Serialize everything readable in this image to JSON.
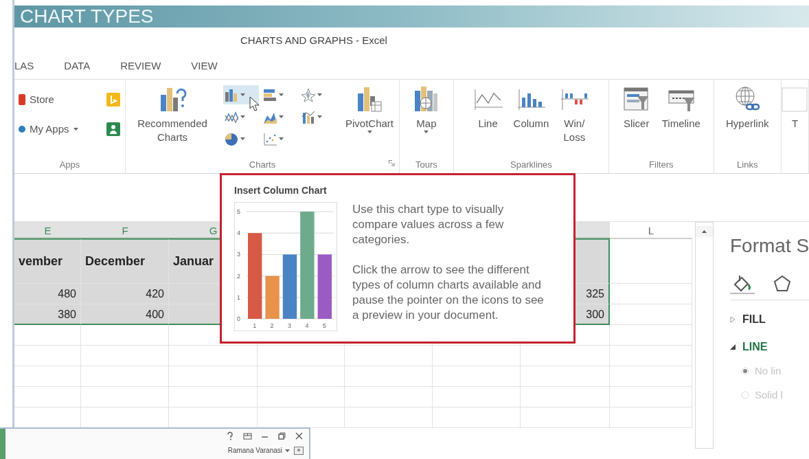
{
  "banner": {
    "title": "CHART TYPES"
  },
  "window": {
    "title": "CHARTS AND GRAPHS - Excel"
  },
  "tabs": [
    {
      "label": "LAS"
    },
    {
      "label": "DATA"
    },
    {
      "label": "REVIEW"
    },
    {
      "label": "VIEW"
    }
  ],
  "ribbon": [
    {
      "label": "Apps",
      "kind": "apps",
      "buttons": [
        {
          "kind": "applist",
          "items": [
            {
              "label": "Store",
              "kind": "store",
              "has_menu": false,
              "addin": {
                "kind": "bing"
              }
            },
            {
              "label": "My Apps",
              "kind": "myapps",
              "has_menu": true,
              "addin": {
                "kind": "people"
              }
            }
          ]
        }
      ]
    },
    {
      "label": "Charts",
      "kind": "charts",
      "dialog_launcher": true,
      "buttons": [
        {
          "kind": "recommended",
          "label": "Recommended Charts",
          "has_menu": false
        },
        {
          "kind": "gallery",
          "items": [
            {
              "kind": "column",
              "highlighted": true,
              "has_menu": true
            },
            {
              "kind": "bar",
              "highlighted": false,
              "has_menu": true
            },
            {
              "kind": "radar",
              "highlighted": false,
              "has_menu": true
            },
            {
              "kind": "line",
              "highlighted": false,
              "has_menu": true
            },
            {
              "kind": "area",
              "highlighted": false,
              "has_menu": true
            },
            {
              "kind": "combo",
              "highlighted": false,
              "has_menu": true
            },
            {
              "kind": "pie",
              "highlighted": false,
              "has_menu": true
            },
            {
              "kind": "scatter",
              "highlighted": false,
              "has_menu": true
            }
          ]
        },
        {
          "kind": "pivotchart",
          "label": "PivotChart",
          "has_menu": true
        }
      ]
    },
    {
      "label": "Tours",
      "kind": "tours",
      "buttons": [
        {
          "kind": "map",
          "label": "Map",
          "has_menu": true
        }
      ]
    },
    {
      "label": "Sparklines",
      "kind": "sparklines",
      "buttons": [
        {
          "kind": "sparkline",
          "label": "Line",
          "has_menu": false
        },
        {
          "kind": "sparkcolumn",
          "label": "Column",
          "has_menu": false
        },
        {
          "kind": "winloss",
          "label": "Win/ Loss",
          "has_menu": false
        }
      ]
    },
    {
      "label": "Filters",
      "kind": "filters",
      "buttons": [
        {
          "kind": "slicer",
          "label": "Slicer",
          "has_menu": false
        },
        {
          "kind": "timeline",
          "label": "Timeline",
          "has_menu": false
        }
      ]
    },
    {
      "label": "Links",
      "kind": "links",
      "buttons": [
        {
          "kind": "hyperlink",
          "label": "Hyperlink",
          "has_menu": false
        }
      ]
    },
    {
      "kind": "partial",
      "buttons": [
        {
          "kind": "textbox",
          "label": "T",
          "has_menu": false
        }
      ]
    }
  ],
  "sheet": {
    "columns": [
      {
        "label": "E",
        "selected": true
      },
      {
        "label": "F",
        "selected": true
      },
      {
        "label": "G",
        "selected": true
      },
      {},
      {},
      {},
      {
        "selected": true
      },
      {
        "label": "L",
        "selected": false
      }
    ],
    "rows": [
      {
        "kind": "header",
        "selected": true,
        "cells": [
          "vember",
          "December",
          "Januar",
          null,
          null,
          null,
          null,
          null
        ]
      },
      {
        "kind": "number",
        "selected": true,
        "cells": [
          "480",
          "420",
          null,
          null,
          null,
          null,
          "325",
          null
        ]
      },
      {
        "kind": "number",
        "selected": true,
        "cells": [
          "380",
          "400",
          null,
          null,
          null,
          null,
          "300",
          null
        ]
      }
    ]
  },
  "tooltip": {
    "title": "Insert Column Chart",
    "paragraphs": [
      "Use this chart type to visually compare values across a few categories.",
      "Click the arrow to see the different types of column charts available and pause the pointer on the icons to see a preview in your document."
    ],
    "chart_data": {
      "type": "bar",
      "categories": [
        "1",
        "2",
        "3",
        "4",
        "5"
      ],
      "values": [
        4,
        2,
        3,
        5,
        3
      ],
      "colors": [
        "#d65a45",
        "#e8934b",
        "#4a84c4",
        "#6dab8c",
        "#9b5bc2"
      ],
      "ylim": [
        0,
        5
      ],
      "yticks": [
        0,
        1,
        2,
        3,
        4,
        5
      ],
      "grid": true
    }
  },
  "format_pane": {
    "title": "Format S",
    "tabs": [
      {
        "kind": "fill",
        "selected": true
      },
      {
        "kind": "shape",
        "selected": false
      }
    ],
    "sections": [
      {
        "label": "FILL",
        "expanded": false
      },
      {
        "label": "LINE",
        "expanded": true
      }
    ],
    "options": [
      {
        "label": "No lin",
        "selected": true,
        "disabled": true
      },
      {
        "label": "Solid l",
        "selected": false,
        "disabled": true
      }
    ]
  },
  "second_window": {
    "user": "Ramana Varanasi",
    "has_menu": true
  }
}
